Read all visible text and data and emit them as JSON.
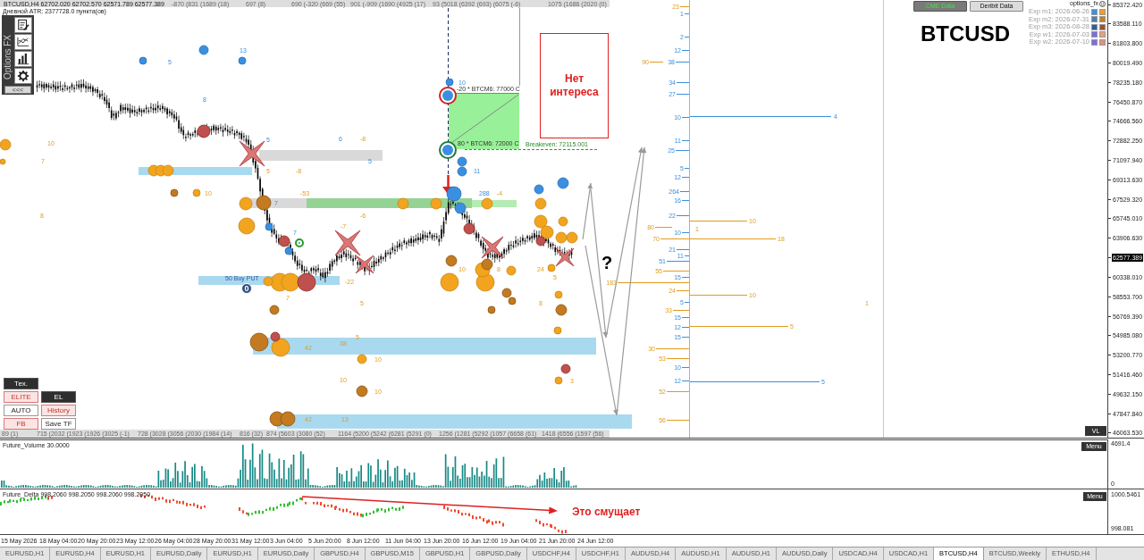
{
  "header": {
    "quote": "BTCUSD,H4  62702.020 62702.570 62571.789 62577.389",
    "atr": "Дневной ATR: 2377728.0 пункта(ов)"
  },
  "top_stats": [
    "-870 (831 (1689 (18)",
    "697 (8)",
    "690 (-320 (669 (55)",
    "901 (-909 (1690 (4925 (17)",
    "93 (5018 (6392 (693) (6075 (-6)",
    "1075 (1686 (2020 (0)"
  ],
  "bottom_stats": [
    "89 (1)",
    "715 (2032 (1923 (1926 (3025 (-1)",
    "728 (3028 (3056 (2030 (1984 (14)",
    "816 (32)",
    "874 (5603 (3080 (52)",
    "1164 (5200 (5242 (6281 (5291 (0)",
    "1256 (1281 (5292 (1057 (6658 (61)",
    "1418 (6556 (1597 (56)"
  ],
  "toolbar": {
    "brand": "Options FX",
    "collapse": "<<<"
  },
  "data_sources": [
    {
      "label": "CME Data",
      "selected": true
    },
    {
      "label": "Deribit Data",
      "selected": false
    }
  ],
  "account_label": "options_fx",
  "expirations": [
    {
      "label": "Exp m1: 2026-06-26",
      "swatches": [
        {
          "color": "#3d8fe0"
        },
        {
          "color": "#f0a020"
        }
      ]
    },
    {
      "label": "Exp m2: 2026-07-31",
      "swatches": [
        {
          "color": "#4f7fb0"
        },
        {
          "color": "#c8801e"
        }
      ]
    },
    {
      "label": "Exp m3: 2026-08-28",
      "swatches": [
        {
          "color": "#2b5fa0"
        },
        {
          "color": "#a0522d"
        }
      ]
    },
    {
      "label": "Exp w1: 2026-07-03",
      "swatches": [
        {
          "color": "#7b6fe0"
        },
        {
          "color": "#e8a080"
        }
      ]
    },
    {
      "label": "Exp w2: 2026-07-10",
      "swatches": [
        {
          "color": "#7b6fe0"
        },
        {
          "color": "#e09080"
        }
      ]
    }
  ],
  "symbol_title": "BTCUSD",
  "note_box": "Нет интереса",
  "question_mark": "?",
  "orders": [
    "-20 * BTCM6: 77000 C",
    "80 * BTCM6: 72000 C"
  ],
  "breakeven": "Breakeven: 72115.001",
  "put_order": {
    "label": "50 Buy PUT",
    "count": "0"
  },
  "chart_labels": [
    {
      "label": "5",
      "kind": "call"
    },
    {
      "label": "13",
      "kind": "call"
    },
    {
      "label": "8",
      "kind": "call"
    },
    {
      "label": "10",
      "kind": "put"
    },
    {
      "label": "7",
      "kind": "put"
    },
    {
      "label": "5",
      "kind": "call"
    },
    {
      "label": "6",
      "kind": "call"
    },
    {
      "label": "-8",
      "kind": "put"
    },
    {
      "label": "5",
      "kind": "call"
    },
    {
      "label": "10",
      "kind": "put"
    },
    {
      "label": "8",
      "kind": "put"
    },
    {
      "label": "5",
      "kind": "put"
    },
    {
      "label": "-8",
      "kind": "put"
    },
    {
      "label": "7",
      "kind": "call"
    },
    {
      "label": "-53",
      "kind": "put"
    },
    {
      "label": "-7",
      "kind": "put"
    },
    {
      "label": "-6",
      "kind": "put"
    },
    {
      "label": "7",
      "kind": "call"
    },
    {
      "label": "-22",
      "kind": "put"
    },
    {
      "label": "5",
      "kind": "put"
    },
    {
      "label": "10",
      "kind": "put"
    },
    {
      "label": "42",
      "kind": "put"
    },
    {
      "label": "38",
      "kind": "put"
    },
    {
      "label": "5",
      "kind": "put"
    },
    {
      "label": "10",
      "kind": "put"
    },
    {
      "label": "10",
      "kind": "put"
    },
    {
      "label": "10",
      "kind": "put"
    },
    {
      "label": "42",
      "kind": "put"
    },
    {
      "label": "13",
      "kind": "put"
    },
    {
      "label": "8",
      "kind": "put"
    },
    {
      "label": "8",
      "kind": "put"
    },
    {
      "label": "24",
      "kind": "put"
    },
    {
      "label": "5",
      "kind": "put"
    },
    {
      "label": "3",
      "kind": "put"
    },
    {
      "label": "10",
      "kind": "call"
    },
    {
      "label": "11",
      "kind": "call"
    },
    {
      "label": "288",
      "kind": "call"
    },
    {
      "label": "-4",
      "kind": "put"
    },
    {
      "label": "7",
      "kind": "put"
    }
  ],
  "strike_labels": [
    {
      "label": "23",
      "kind": "put"
    },
    {
      "label": "1",
      "kind": "call"
    },
    {
      "label": "2",
      "kind": "call"
    },
    {
      "label": "12",
      "kind": "call"
    },
    {
      "label": "90",
      "kind": "put"
    },
    {
      "label": "38",
      "kind": "call"
    },
    {
      "label": "34",
      "kind": "call"
    },
    {
      "label": "27",
      "kind": "call"
    },
    {
      "label": "10",
      "kind": "call"
    },
    {
      "label": "11",
      "kind": "call"
    },
    {
      "label": "25",
      "kind": "call"
    },
    {
      "label": "5",
      "kind": "call"
    },
    {
      "label": "12",
      "kind": "call"
    },
    {
      "label": "264",
      "kind": "call"
    },
    {
      "label": "16",
      "kind": "call"
    },
    {
      "label": "22",
      "kind": "call"
    },
    {
      "label": "80",
      "kind": "put"
    },
    {
      "label": "10",
      "kind": "call"
    },
    {
      "label": "70",
      "kind": "put"
    },
    {
      "label": "21",
      "kind": "call"
    },
    {
      "label": "11",
      "kind": "call"
    },
    {
      "label": "51",
      "kind": "call"
    },
    {
      "label": "55",
      "kind": "put"
    },
    {
      "label": "15",
      "kind": "call"
    },
    {
      "label": "183",
      "kind": "put"
    },
    {
      "label": "24",
      "kind": "put"
    },
    {
      "label": "5",
      "kind": "call"
    },
    {
      "label": "33",
      "kind": "put"
    },
    {
      "label": "15",
      "kind": "call"
    },
    {
      "label": "12",
      "kind": "call"
    },
    {
      "label": "15",
      "kind": "call"
    },
    {
      "label": "30",
      "kind": "put"
    },
    {
      "label": "53",
      "kind": "put"
    },
    {
      "label": "10",
      "kind": "call"
    },
    {
      "label": "12",
      "kind": "call"
    },
    {
      "label": "52",
      "kind": "put"
    },
    {
      "label": "56",
      "kind": "put"
    },
    {
      "label": "4",
      "kind": "call"
    },
    {
      "label": "10",
      "kind": "put"
    },
    {
      "label": "1",
      "kind": "put"
    },
    {
      "label": "18",
      "kind": "put"
    },
    {
      "label": "10",
      "kind": "put"
    },
    {
      "label": "1",
      "kind": "put"
    },
    {
      "label": "5",
      "kind": "put"
    },
    {
      "label": "5",
      "kind": "call"
    }
  ],
  "price_axis": [
    {
      "label": "85372.420",
      "kind": "tick"
    },
    {
      "label": "83588.110",
      "kind": "tick"
    },
    {
      "label": "81803.800",
      "kind": "tick"
    },
    {
      "label": "80019.490",
      "kind": "tick"
    },
    {
      "label": "78235.180",
      "kind": "tick"
    },
    {
      "label": "76450.870",
      "kind": "tick"
    },
    {
      "label": "74666.560",
      "kind": "tick"
    },
    {
      "label": "72882.250",
      "kind": "tick"
    },
    {
      "label": "71097.940",
      "kind": "tick"
    },
    {
      "label": "69313.630",
      "kind": "tick"
    },
    {
      "label": "67529.320",
      "kind": "tick"
    },
    {
      "label": "65745.010",
      "kind": "tick"
    },
    {
      "label": "63906.630",
      "kind": "tick"
    },
    {
      "label": "62577.389",
      "kind": "current"
    },
    {
      "label": "60338.010",
      "kind": "tick"
    },
    {
      "label": "58553.700",
      "kind": "tick"
    },
    {
      "label": "56769.390",
      "kind": "tick"
    },
    {
      "label": "54985.080",
      "kind": "tick"
    },
    {
      "label": "53200.770",
      "kind": "tick"
    },
    {
      "label": "51416.460",
      "kind": "tick"
    },
    {
      "label": "49632.150",
      "kind": "tick"
    },
    {
      "label": "47847.840",
      "kind": "tick"
    },
    {
      "label": "46063.530",
      "kind": "tick"
    }
  ],
  "panel_buttons": [
    [
      {
        "label": "Тех.",
        "kind": "dark"
      }
    ],
    [
      {
        "label": "ELITE",
        "kind": "alert"
      },
      {
        "label": "EL",
        "kind": "dark"
      }
    ],
    [
      {
        "label": "AUTO",
        "kind": "plain"
      },
      {
        "label": "History",
        "kind": "alert"
      }
    ],
    [
      {
        "label": "FB",
        "kind": "alert"
      },
      {
        "label": "Save TF",
        "kind": "plain"
      }
    ]
  ],
  "vl_button": "VL",
  "volume_panel": {
    "title": "Future_Volume 30.0000",
    "menu": "Menu",
    "axis": [
      "4691.4",
      "0"
    ]
  },
  "delta_panel": {
    "title": "Future_Delta 998.2060 998.2050 998.2060 998.2050",
    "menu": "Menu",
    "axis": [
      "1000.5461",
      "998.081"
    ],
    "note": "Это смущает"
  },
  "time_axis": [
    "15 May 2026",
    "18 May 04:00",
    "20 May 20:00",
    "23 May 12:00",
    "26 May 04:00",
    "28 May 20:00",
    "31 May 12:00",
    "3 Jun 04:00",
    "5 Jun 20:00",
    "8 Jun 12:00",
    "11 Jun 04:00",
    "13 Jun 20:00",
    "16 Jun 12:00",
    "19 Jun 04:00",
    "21 Jun 20:00",
    "24 Jun 12:00"
  ],
  "tabs": [
    {
      "label": "EURUSD,H1",
      "selected": false
    },
    {
      "label": "EURUSD,H4",
      "selected": false
    },
    {
      "label": "EURUSD,H1",
      "selected": false
    },
    {
      "label": "EURUSD,Daily",
      "selected": false
    },
    {
      "label": "EURUSD,H1",
      "selected": false
    },
    {
      "label": "EURUSD,Daily",
      "selected": false
    },
    {
      "label": "GBPUSD,H4",
      "selected": false
    },
    {
      "label": "GBPUSD,M15",
      "selected": false
    },
    {
      "label": "GBPUSD,H1",
      "selected": false
    },
    {
      "label": "GBPUSD,Daily",
      "selected": false
    },
    {
      "label": "USDCHF,H4",
      "selected": false
    },
    {
      "label": "USDCHF,H1",
      "selected": false
    },
    {
      "label": "AUDUSD,H4",
      "selected": false
    },
    {
      "label": "AUDUSD,H1",
      "selected": false
    },
    {
      "label": "AUDUSD,H1",
      "selected": false
    },
    {
      "label": "AUDUSD,Daily",
      "selected": false
    },
    {
      "label": "USDCAD,H4",
      "selected": false
    },
    {
      "label": "USDCAD,H1",
      "selected": false
    },
    {
      "label": "BTCUSD,H4",
      "selected": true
    },
    {
      "label": "BTCUSD,Weekly",
      "selected": false
    },
    {
      "label": "ETHUSD,H4",
      "selected": false
    }
  ]
}
